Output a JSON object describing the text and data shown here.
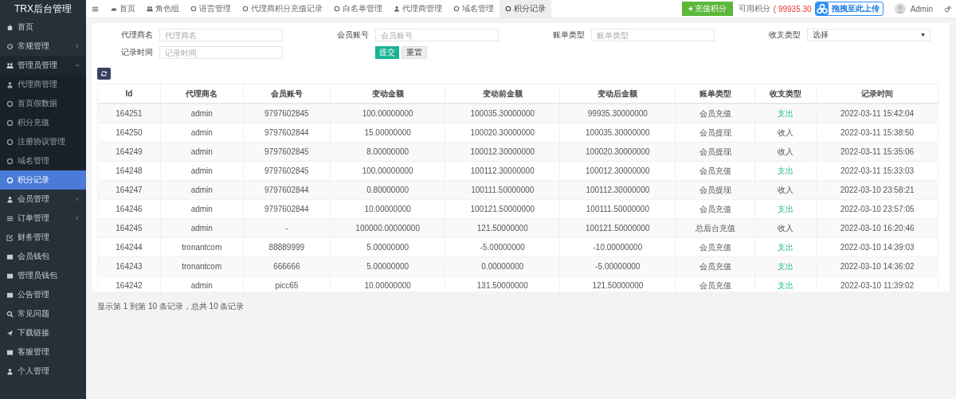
{
  "brand": "TRX后台管理",
  "sidebar": {
    "items": [
      {
        "label": "首页",
        "kind": "home",
        "selected": false
      },
      {
        "label": "常规管理",
        "kind": "gear",
        "selected": false,
        "expanded": false
      },
      {
        "label": "管理员管理",
        "kind": "users",
        "selected": false,
        "expanded": true,
        "children": [
          {
            "label": "代理商管理",
            "kind": "user",
            "selected": false
          },
          {
            "label": "首页假数据",
            "kind": "circle",
            "selected": false
          },
          {
            "label": "积分充值",
            "kind": "circle",
            "selected": false
          },
          {
            "label": "注册协议管理",
            "kind": "circle",
            "selected": false
          },
          {
            "label": "域名管理",
            "kind": "circle",
            "selected": false
          },
          {
            "label": "积分记录",
            "kind": "circle",
            "selected": true
          }
        ]
      },
      {
        "label": "会员管理",
        "kind": "user",
        "selected": false,
        "expanded": false
      },
      {
        "label": "订单管理",
        "kind": "list",
        "selected": false,
        "expanded": false
      },
      {
        "label": "财务管理",
        "kind": "pencil",
        "selected": false
      },
      {
        "label": "会员钱包",
        "kind": "square",
        "selected": false
      },
      {
        "label": "管理员钱包",
        "kind": "square",
        "selected": false
      },
      {
        "label": "公告管理",
        "kind": "square",
        "selected": false
      },
      {
        "label": "常见问题",
        "kind": "search",
        "selected": false
      },
      {
        "label": "下载链接",
        "kind": "plane",
        "selected": false
      },
      {
        "label": "客服管理",
        "kind": "square",
        "selected": false
      },
      {
        "label": "个人管理",
        "kind": "user",
        "selected": false
      }
    ]
  },
  "tabs": [
    {
      "label": "首页",
      "kind": "gauge",
      "selected": false
    },
    {
      "label": "角色组",
      "kind": "users",
      "selected": false
    },
    {
      "label": "语言管理",
      "kind": "circle",
      "selected": false
    },
    {
      "label": "代理商积分充值记录",
      "kind": "circle",
      "selected": false
    },
    {
      "label": "白名单管理",
      "kind": "circle",
      "selected": false
    },
    {
      "label": "代理商管理",
      "kind": "user",
      "selected": false
    },
    {
      "label": "域名管理",
      "kind": "circle",
      "selected": false
    },
    {
      "label": "积分记录",
      "kind": "circle",
      "selected": true
    }
  ],
  "header": {
    "recharge_button": "充值积分",
    "balance_label": "可用积分",
    "balance_value": "( 99935.30",
    "upload_badge": "拖拽至此上传",
    "user": "Admin"
  },
  "filters": [
    {
      "label": "代理商名",
      "kind": "text",
      "placeholder": "代理商名"
    },
    {
      "label": "会员账号",
      "kind": "text",
      "placeholder": "会员账号"
    },
    {
      "label": "账单类型",
      "kind": "text",
      "placeholder": "账单类型"
    },
    {
      "label": "收支类型",
      "kind": "select",
      "value": "选择"
    },
    {
      "label": "记录时间",
      "kind": "text",
      "placeholder": "记录时间"
    }
  ],
  "submit_button": "提交",
  "reset_button": "重置",
  "table": {
    "columns": [
      "Id",
      "代理商名",
      "会员账号",
      "变动金额",
      "变动前金额",
      "变动后金额",
      "账单类型",
      "收支类型",
      "记录时间"
    ],
    "rows": [
      {
        "cells": [
          "164251",
          "admin",
          "9797602845",
          "100.00000000",
          "100035.30000000",
          "99935.30000000",
          "会员充值",
          "支出",
          "2022-03-11 15:42:04"
        ],
        "highlight": true
      },
      {
        "cells": [
          "164250",
          "admin",
          "9797602844",
          "15.00000000",
          "100020.30000000",
          "100035.30000000",
          "会员提现",
          "收入",
          "2022-03-11 15:38:50"
        ],
        "highlight": false
      },
      {
        "cells": [
          "164249",
          "admin",
          "9797602845",
          "8.00000000",
          "100012.30000000",
          "100020.30000000",
          "会员提现",
          "收入",
          "2022-03-11 15:35:06"
        ],
        "highlight": false
      },
      {
        "cells": [
          "164248",
          "admin",
          "9797602845",
          "100.00000000",
          "100112.30000000",
          "100012.30000000",
          "会员充值",
          "支出",
          "2022-03-11 15:33:03"
        ],
        "highlight": true
      },
      {
        "cells": [
          "164247",
          "admin",
          "9797602844",
          "0.80000000",
          "100111.50000000",
          "100112.30000000",
          "会员提现",
          "收入",
          "2022-03-10 23:58:21"
        ],
        "highlight": false
      },
      {
        "cells": [
          "164246",
          "admin",
          "9797602844",
          "10.00000000",
          "100121.50000000",
          "100111.50000000",
          "会员充值",
          "支出",
          "2022-03-10 23:57:05"
        ],
        "highlight": true
      },
      {
        "cells": [
          "164245",
          "admin",
          "-",
          "100000.00000000",
          "121.50000000",
          "100121.50000000",
          "总后台充值",
          "收入",
          "2022-03-10 16:20:46"
        ],
        "highlight": false
      },
      {
        "cells": [
          "164244",
          "tronantcom",
          "88889999",
          "5.00000000",
          "-5.00000000",
          "-10.00000000",
          "会员充值",
          "支出",
          "2022-03-10 14:39:03"
        ],
        "highlight": true
      },
      {
        "cells": [
          "164243",
          "tronantcom",
          "666666",
          "5.00000000",
          "0.00000000",
          "-5.00000000",
          "会员充值",
          "支出",
          "2022-03-10 14:36:02"
        ],
        "highlight": true
      },
      {
        "cells": [
          "164242",
          "admin",
          "picc65",
          "10.00000000",
          "131.50000000",
          "121.50000000",
          "会员充值",
          "支出",
          "2022-03-10 11:39:02"
        ],
        "highlight": true
      }
    ]
  },
  "pagination_info": "显示第 1 到第 10 条记录，总共 10 条记录"
}
